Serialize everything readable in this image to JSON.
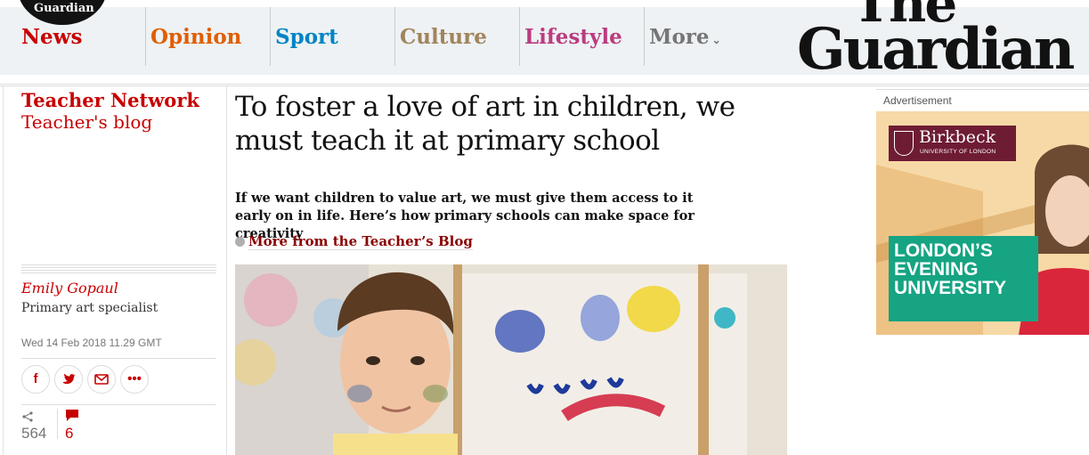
{
  "header": {
    "roundel_text": "Guardian",
    "logo_line1": "The",
    "logo_line2": "Guardian",
    "nav": [
      {
        "label": "News",
        "color": "#c70000"
      },
      {
        "label": "Opinion",
        "color": "#e05e00"
      },
      {
        "label": "Sport",
        "color": "#0084c6"
      },
      {
        "label": "Culture",
        "color": "#a1845c"
      },
      {
        "label": "Lifestyle",
        "color": "#bb3b80"
      },
      {
        "label": "More",
        "color": "#767676"
      }
    ]
  },
  "sidebar": {
    "section": "Teacher Network",
    "series": "Teacher's blog",
    "author": "Emily Gopaul",
    "bio": "Primary art specialist",
    "date": "Wed 14 Feb 2018 11.29 GMT",
    "share_count": "564",
    "comment_count": "6"
  },
  "article": {
    "headline": "To foster a love of art in children, we must teach it at primary school",
    "standfirst": "If we want children to value art, we must give them access to it early on in life. Here’s how primary schools can make space for creativity",
    "more_link": "More from the Teacher’s Blog"
  },
  "ad": {
    "label": "Advertisement",
    "brand": "Birkbeck",
    "brand_sub": "UNIVERSITY OF LONDON",
    "headline_l1": "LONDON’S",
    "headline_l2": "EVENING",
    "headline_l3": "UNIVERSITY"
  }
}
